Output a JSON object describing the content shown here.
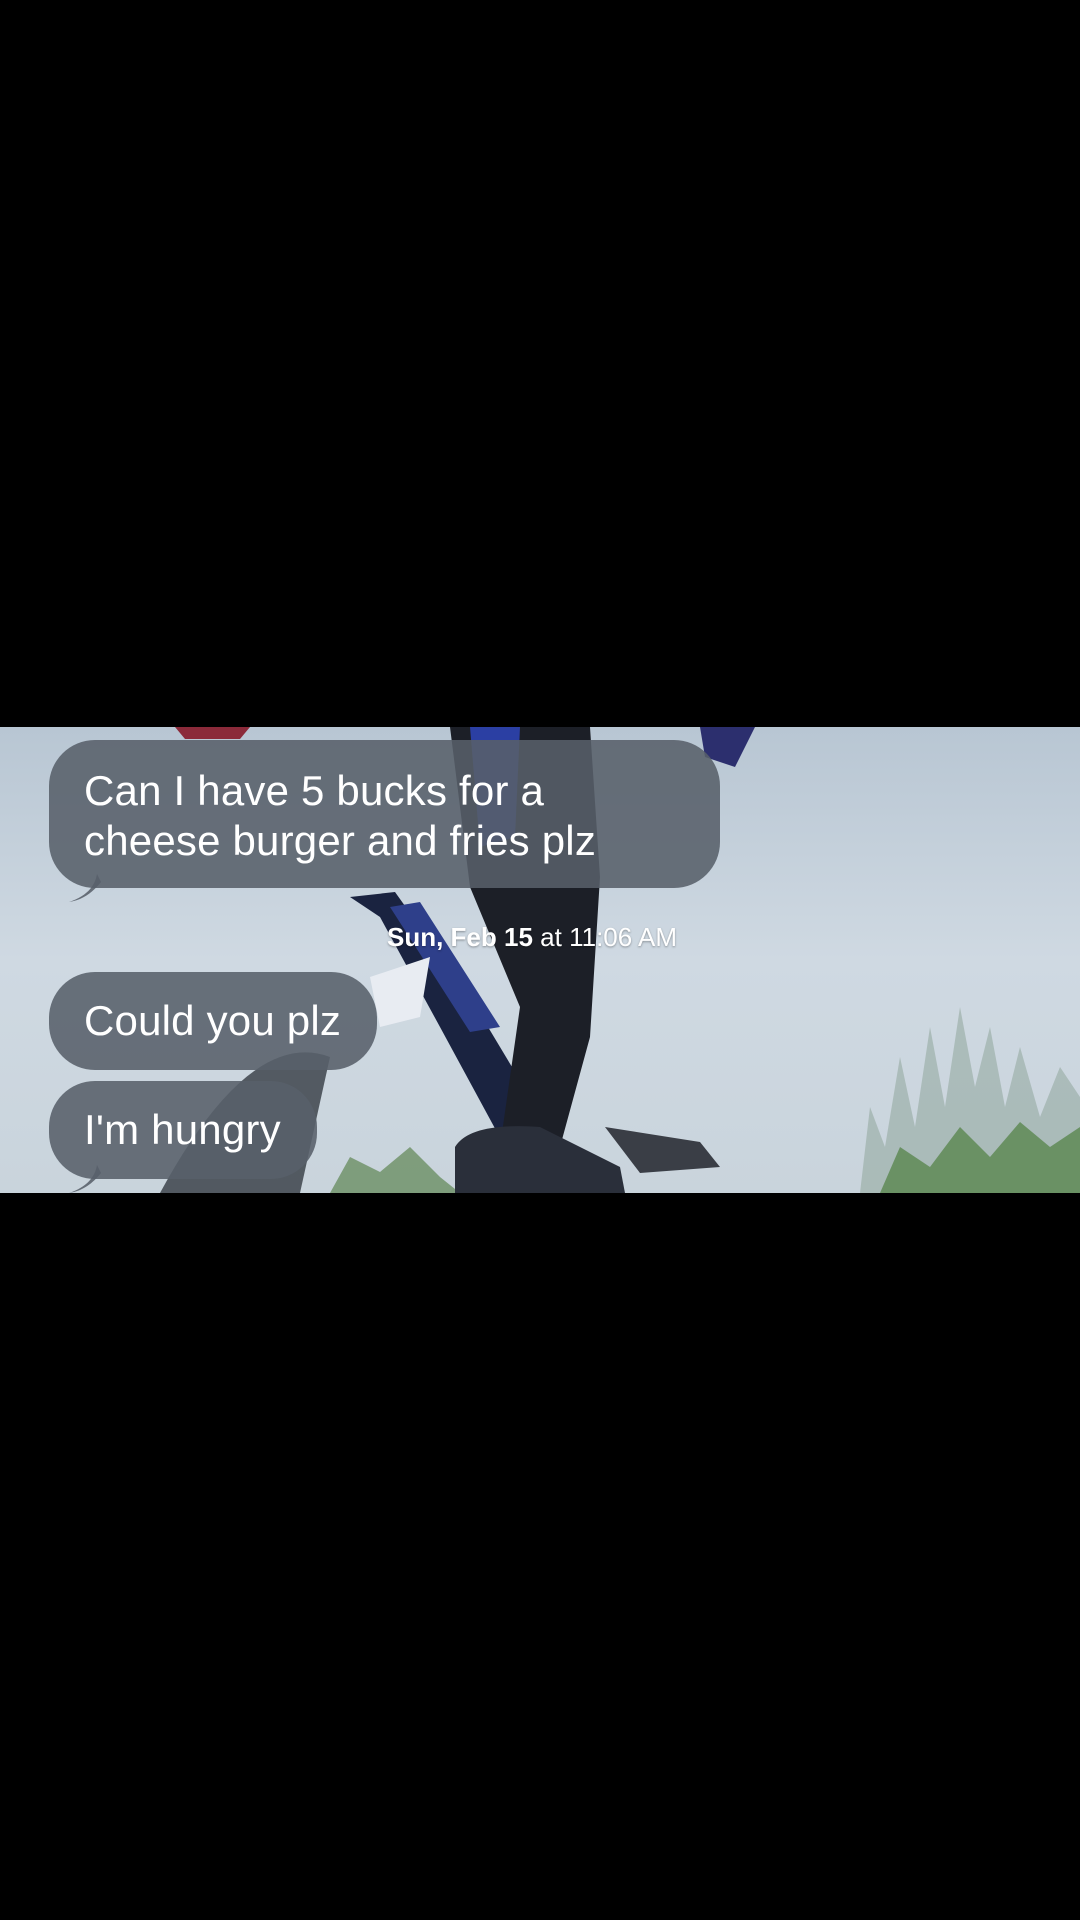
{
  "messages": [
    {
      "text": "Can I have 5 bucks for a cheese burger and fries plz"
    },
    {
      "text": "Could you plz"
    },
    {
      "text": "I'm hungry"
    }
  ],
  "timestamp": {
    "day": "Sun, Feb 15",
    "connector": "at",
    "time": "11:06 AM"
  },
  "colors": {
    "bubble": "#58606a",
    "background": "#000000",
    "text": "#ffffff"
  },
  "icons": {
    "wallpaper": "bmx-rider-wallpaper-image"
  }
}
